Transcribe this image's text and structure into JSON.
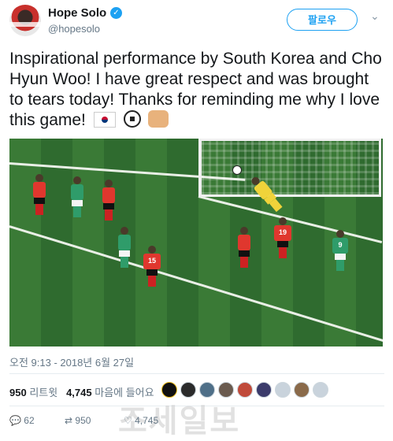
{
  "author": {
    "name": "Hope Solo",
    "handle": "@hopesolo",
    "verified_icon": "verified-badge-icon",
    "follow_label": "팔로우"
  },
  "tweet": {
    "text": "Inspirational performance by South Korea and Cho Hyun Woo! I have great respect and was brought to tears today! Thanks for reminding me why I love this game!",
    "emojis": [
      "south-korea-flag-icon",
      "soccer-ball-icon",
      "fist-bump-icon"
    ],
    "timestamp": "오전 9:13 - 2018년 6월 27일"
  },
  "stats": {
    "retweets_count": "950",
    "retweets_label": "리트윗",
    "likes_count": "4,745",
    "likes_label": "마음에 들어요"
  },
  "actions": {
    "reply_count": "62",
    "retweet_count": "950",
    "like_count": "4,745"
  },
  "colors": {
    "accent": "#1da1f2",
    "muted": "#657786",
    "text": "#14171a",
    "korea_red": "#e0372e",
    "germany_green": "#2f9c6a"
  },
  "photo": {
    "jersey_numbers": [
      "15",
      "19",
      "9"
    ]
  },
  "watermark": "조세일보"
}
